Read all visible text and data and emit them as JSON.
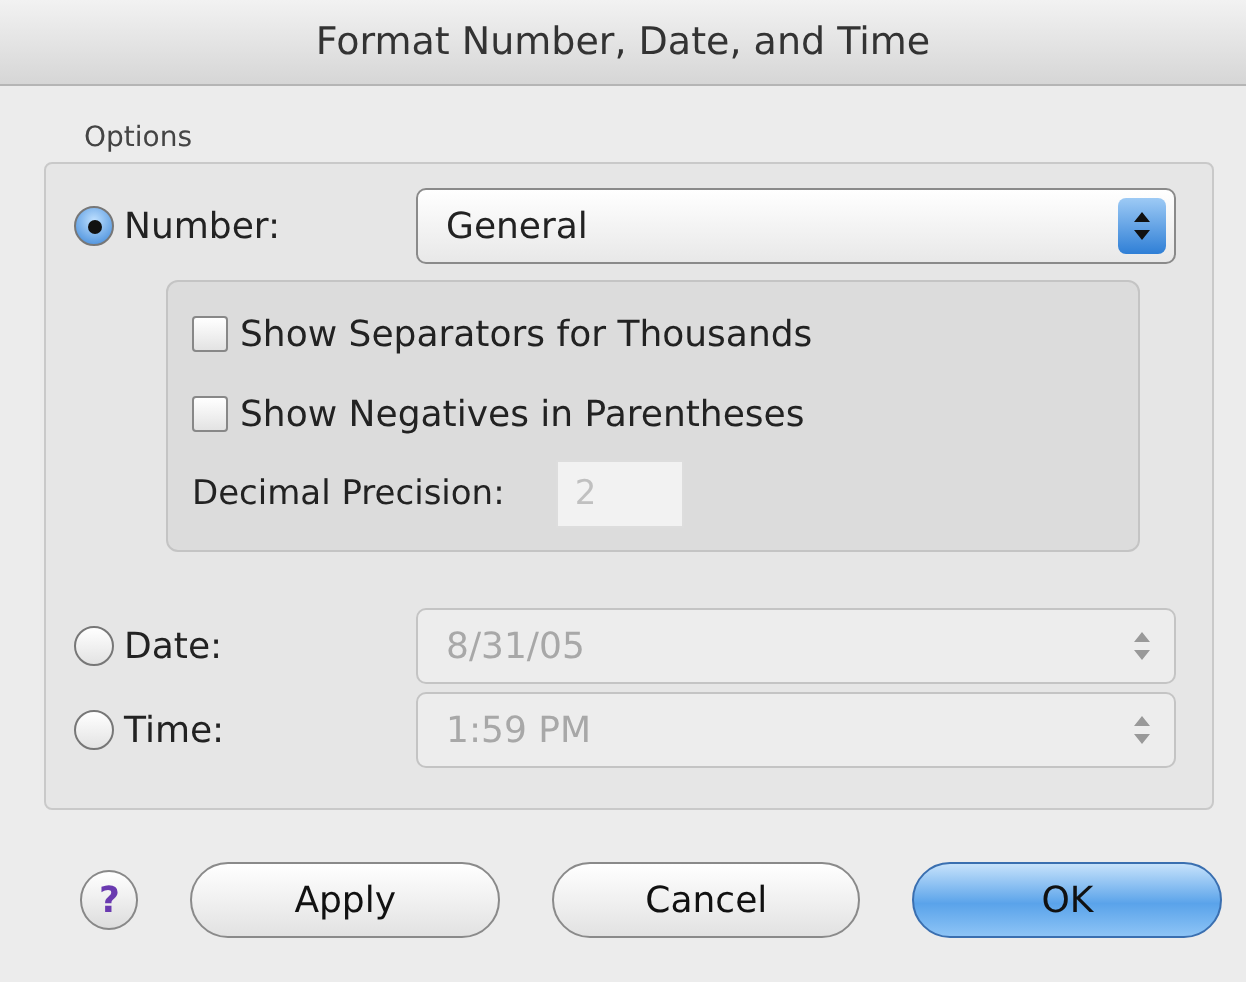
{
  "window": {
    "title": "Format Number, Date, and Time"
  },
  "options_label": "Options",
  "formats": [
    {
      "kind": "number",
      "label": "Number:",
      "selected": true,
      "value": "General",
      "disabled": false
    },
    {
      "kind": "date",
      "label": "Date:",
      "selected": false,
      "value": "8/31/05",
      "disabled": true
    },
    {
      "kind": "time",
      "label": "Time:",
      "selected": false,
      "value": "1:59 PM",
      "disabled": true
    }
  ],
  "number_options": {
    "checkboxes": [
      {
        "label": "Show Separators for Thousands",
        "checked": false
      },
      {
        "label": "Show Negatives in Parentheses",
        "checked": false
      }
    ],
    "precision_label": "Decimal Precision:",
    "precision_value": "2",
    "precision_disabled": true
  },
  "help": "?",
  "buttons": [
    {
      "label": "Apply",
      "default": false
    },
    {
      "label": "Cancel",
      "default": false
    },
    {
      "label": "OK",
      "default": true
    }
  ]
}
